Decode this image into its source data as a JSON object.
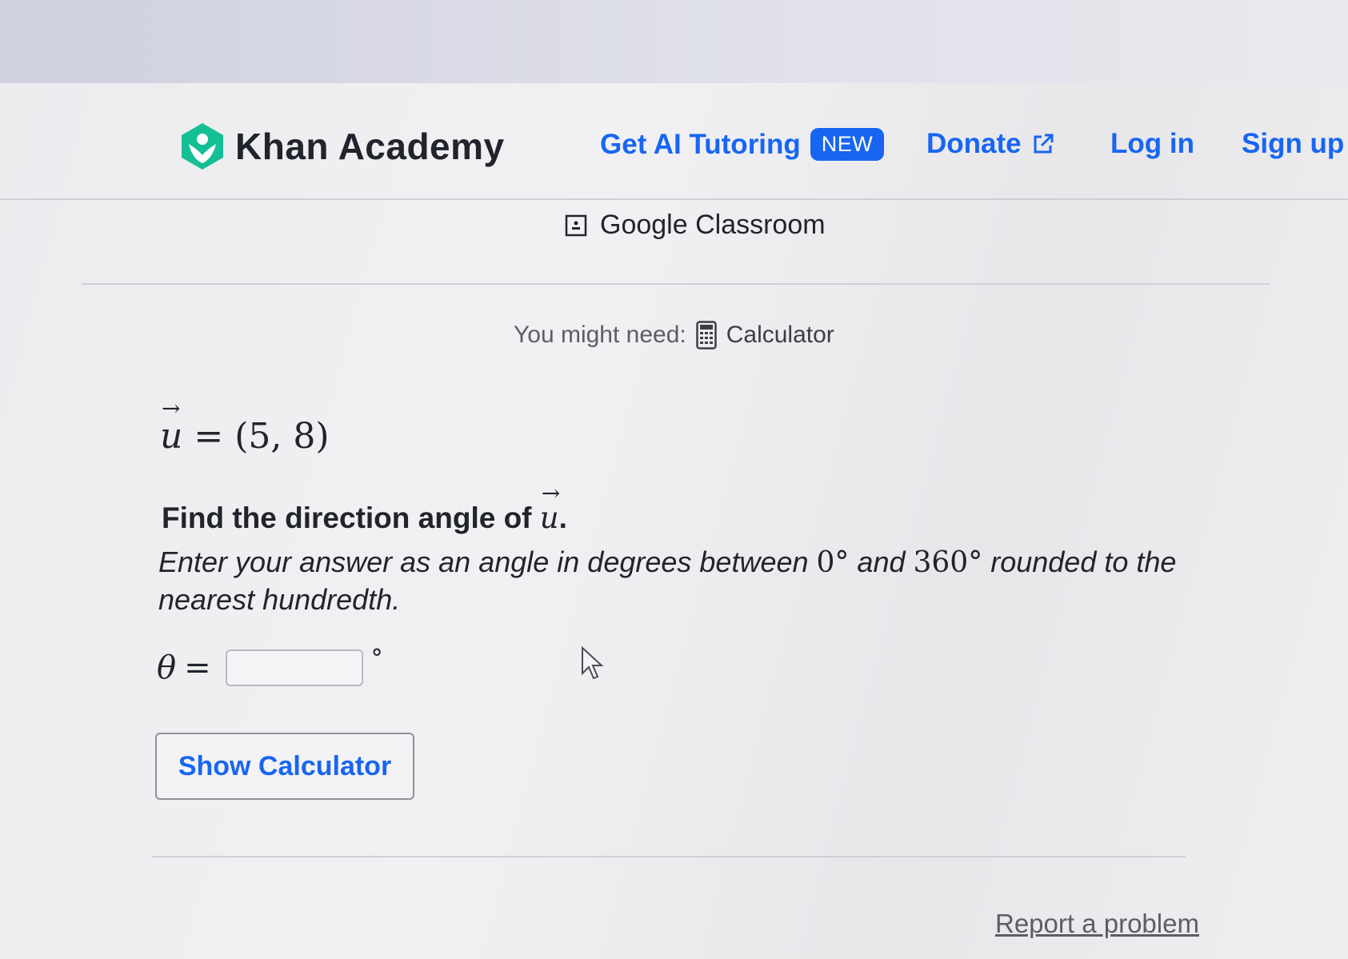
{
  "header": {
    "brand": "Khan Academy",
    "nav_ai": "Get AI Tutoring",
    "badge": "NEW",
    "nav_donate": "Donate",
    "nav_login": "Log in",
    "nav_signup": "Sign up",
    "brand_color": "#14bf96",
    "link_color": "#1865f2"
  },
  "classroom": {
    "label": "Google Classroom",
    "icon": "classroom-icon"
  },
  "need": {
    "prefix": "You might need:",
    "tool": "Calculator",
    "icon": "calculator-icon"
  },
  "problem": {
    "vector_var": "u",
    "vector_value": "= (5, 8)",
    "question_prefix": "Find the direction angle of ",
    "question_var": "u",
    "question_suffix": ".",
    "instr_1": "Enter your answer as an angle in degrees between ",
    "instr_min": "0°",
    "instr_2": " and ",
    "instr_max": "360°",
    "instr_3": " rounded to the nearest hundredth.",
    "answer_var": "θ",
    "answer_eq": "=",
    "answer_value": "",
    "answer_unit": "°"
  },
  "actions": {
    "show_calculator": "Show Calculator",
    "report": "Report a problem"
  }
}
